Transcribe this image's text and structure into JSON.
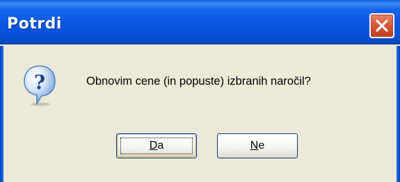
{
  "dialog": {
    "title": "Potrdi",
    "message": "Obnovim cene (in popuste) izbranih naročil?",
    "icon": "question-icon"
  },
  "buttons": {
    "yes_mnemonic": "D",
    "yes_rest": "a",
    "no_mnemonic": "N",
    "no_rest": "e"
  },
  "colors": {
    "title_bar": "#0a57e3",
    "dialog_bg": "#ece9d8",
    "close_button": "#d95c3d"
  }
}
